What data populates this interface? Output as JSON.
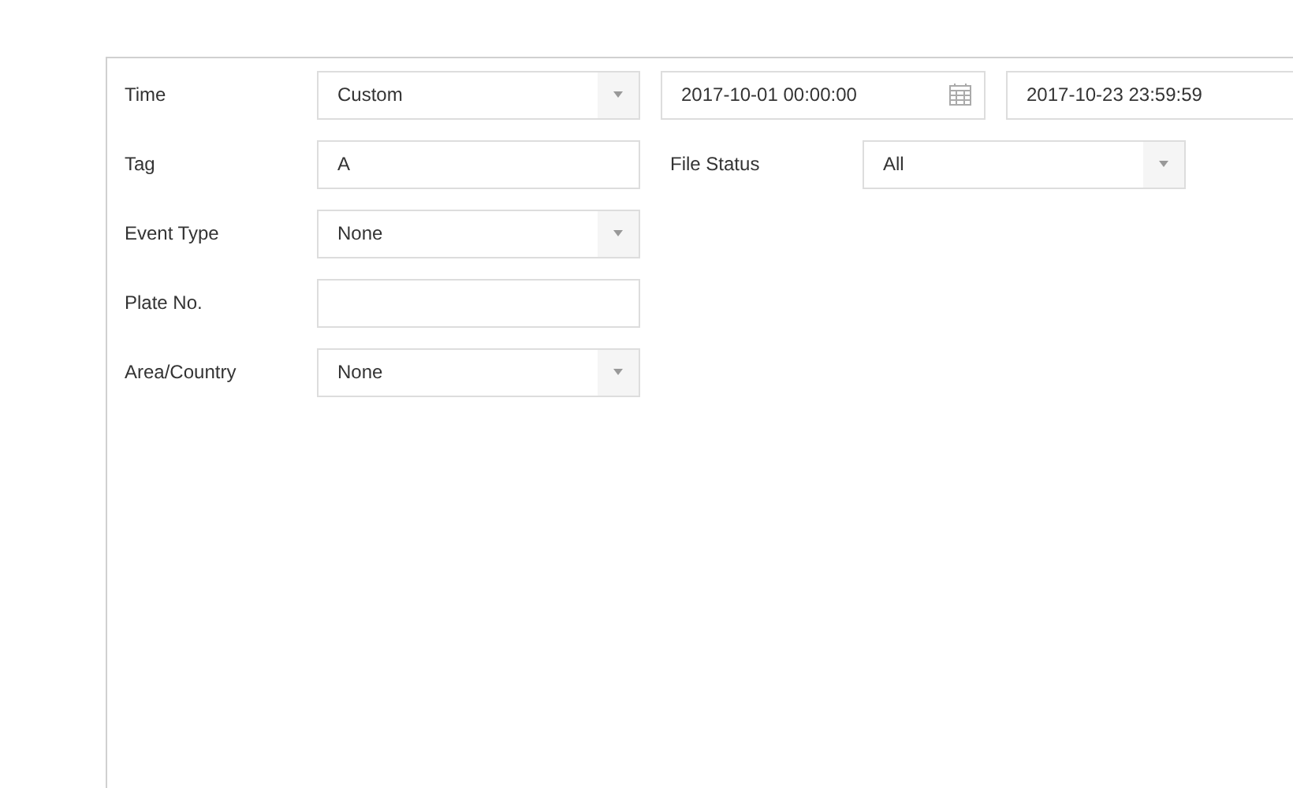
{
  "rows": [
    {
      "items": [
        {
          "kind": "label",
          "text": "Time"
        },
        {
          "kind": "select",
          "value": "Custom"
        },
        {
          "kind": "date",
          "value": "2017-10-01 00:00:00"
        },
        {
          "kind": "date",
          "value": "2017-10-23 23:59:59"
        }
      ]
    },
    {
      "items": [
        {
          "kind": "label",
          "text": "Tag"
        },
        {
          "kind": "text",
          "value": "A"
        },
        {
          "kind": "label",
          "text": "File Status"
        },
        {
          "kind": "select",
          "value": "All"
        }
      ]
    },
    {
      "items": [
        {
          "kind": "label",
          "text": "Event Type"
        },
        {
          "kind": "select",
          "value": "None"
        }
      ]
    },
    {
      "items": [
        {
          "kind": "label",
          "text": "Plate No."
        },
        {
          "kind": "text",
          "value": ""
        }
      ]
    },
    {
      "items": [
        {
          "kind": "label",
          "text": "Area/Country"
        },
        {
          "kind": "select",
          "value": "None"
        }
      ]
    }
  ]
}
